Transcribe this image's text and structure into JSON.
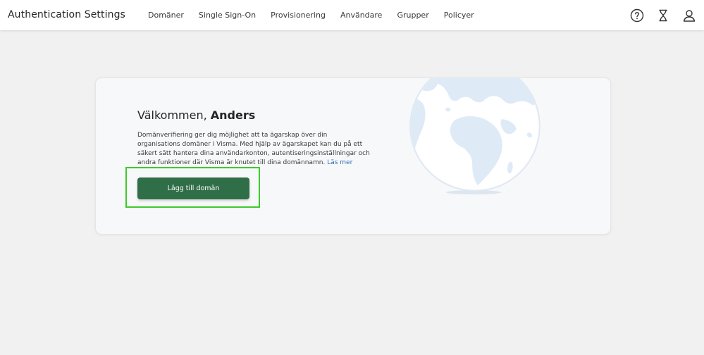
{
  "app": {
    "title": "Authentication Settings"
  },
  "nav": {
    "items": [
      {
        "label": "Domäner"
      },
      {
        "label": "Single Sign-On"
      },
      {
        "label": "Provisionering"
      },
      {
        "label": "Användare"
      },
      {
        "label": "Grupper"
      },
      {
        "label": "Policyer"
      }
    ]
  },
  "header_icons": [
    "help-icon",
    "hourglass-icon",
    "user-icon"
  ],
  "welcome": {
    "greeting": "Välkommen,",
    "name": "Anders",
    "description": "Domänverifiering ger dig möjlighet att ta ägarskap över din organisations domäner i Visma. Med hjälp av ägarskapet kan du på ett säkert sätt hantera dina användarkonton, autentiseringsinställningar och andra funktioner där Visma är knutet till dina domännamn.",
    "read_more": "Läs mer",
    "button_label": "Lägg till domän"
  },
  "colors": {
    "primary_button": "#2f6e46",
    "link": "#2e6fb5",
    "highlight": "#3fca2b",
    "globe_ocean": "#ffffff",
    "globe_land": "#deebf7"
  }
}
